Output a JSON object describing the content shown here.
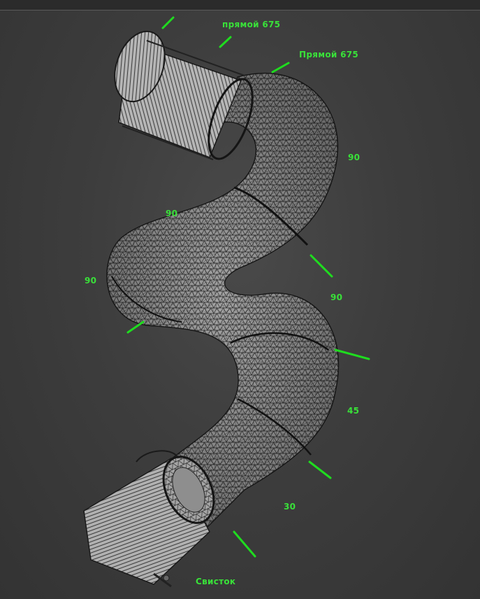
{
  "viewport": {
    "labels": {
      "straight_top_1": "прямой 675",
      "straight_top_2": "Прямой 675",
      "bend_right_upper": "90",
      "bend_left_top": "90",
      "bend_left": "90",
      "bend_right_mid": "90",
      "bend_45": "45",
      "bend_30": "30",
      "whistle": "Свисток"
    },
    "colors": {
      "marker": "#1fdc1f",
      "wire": "#1e1e1e",
      "surface": "#9a9a9a"
    }
  }
}
